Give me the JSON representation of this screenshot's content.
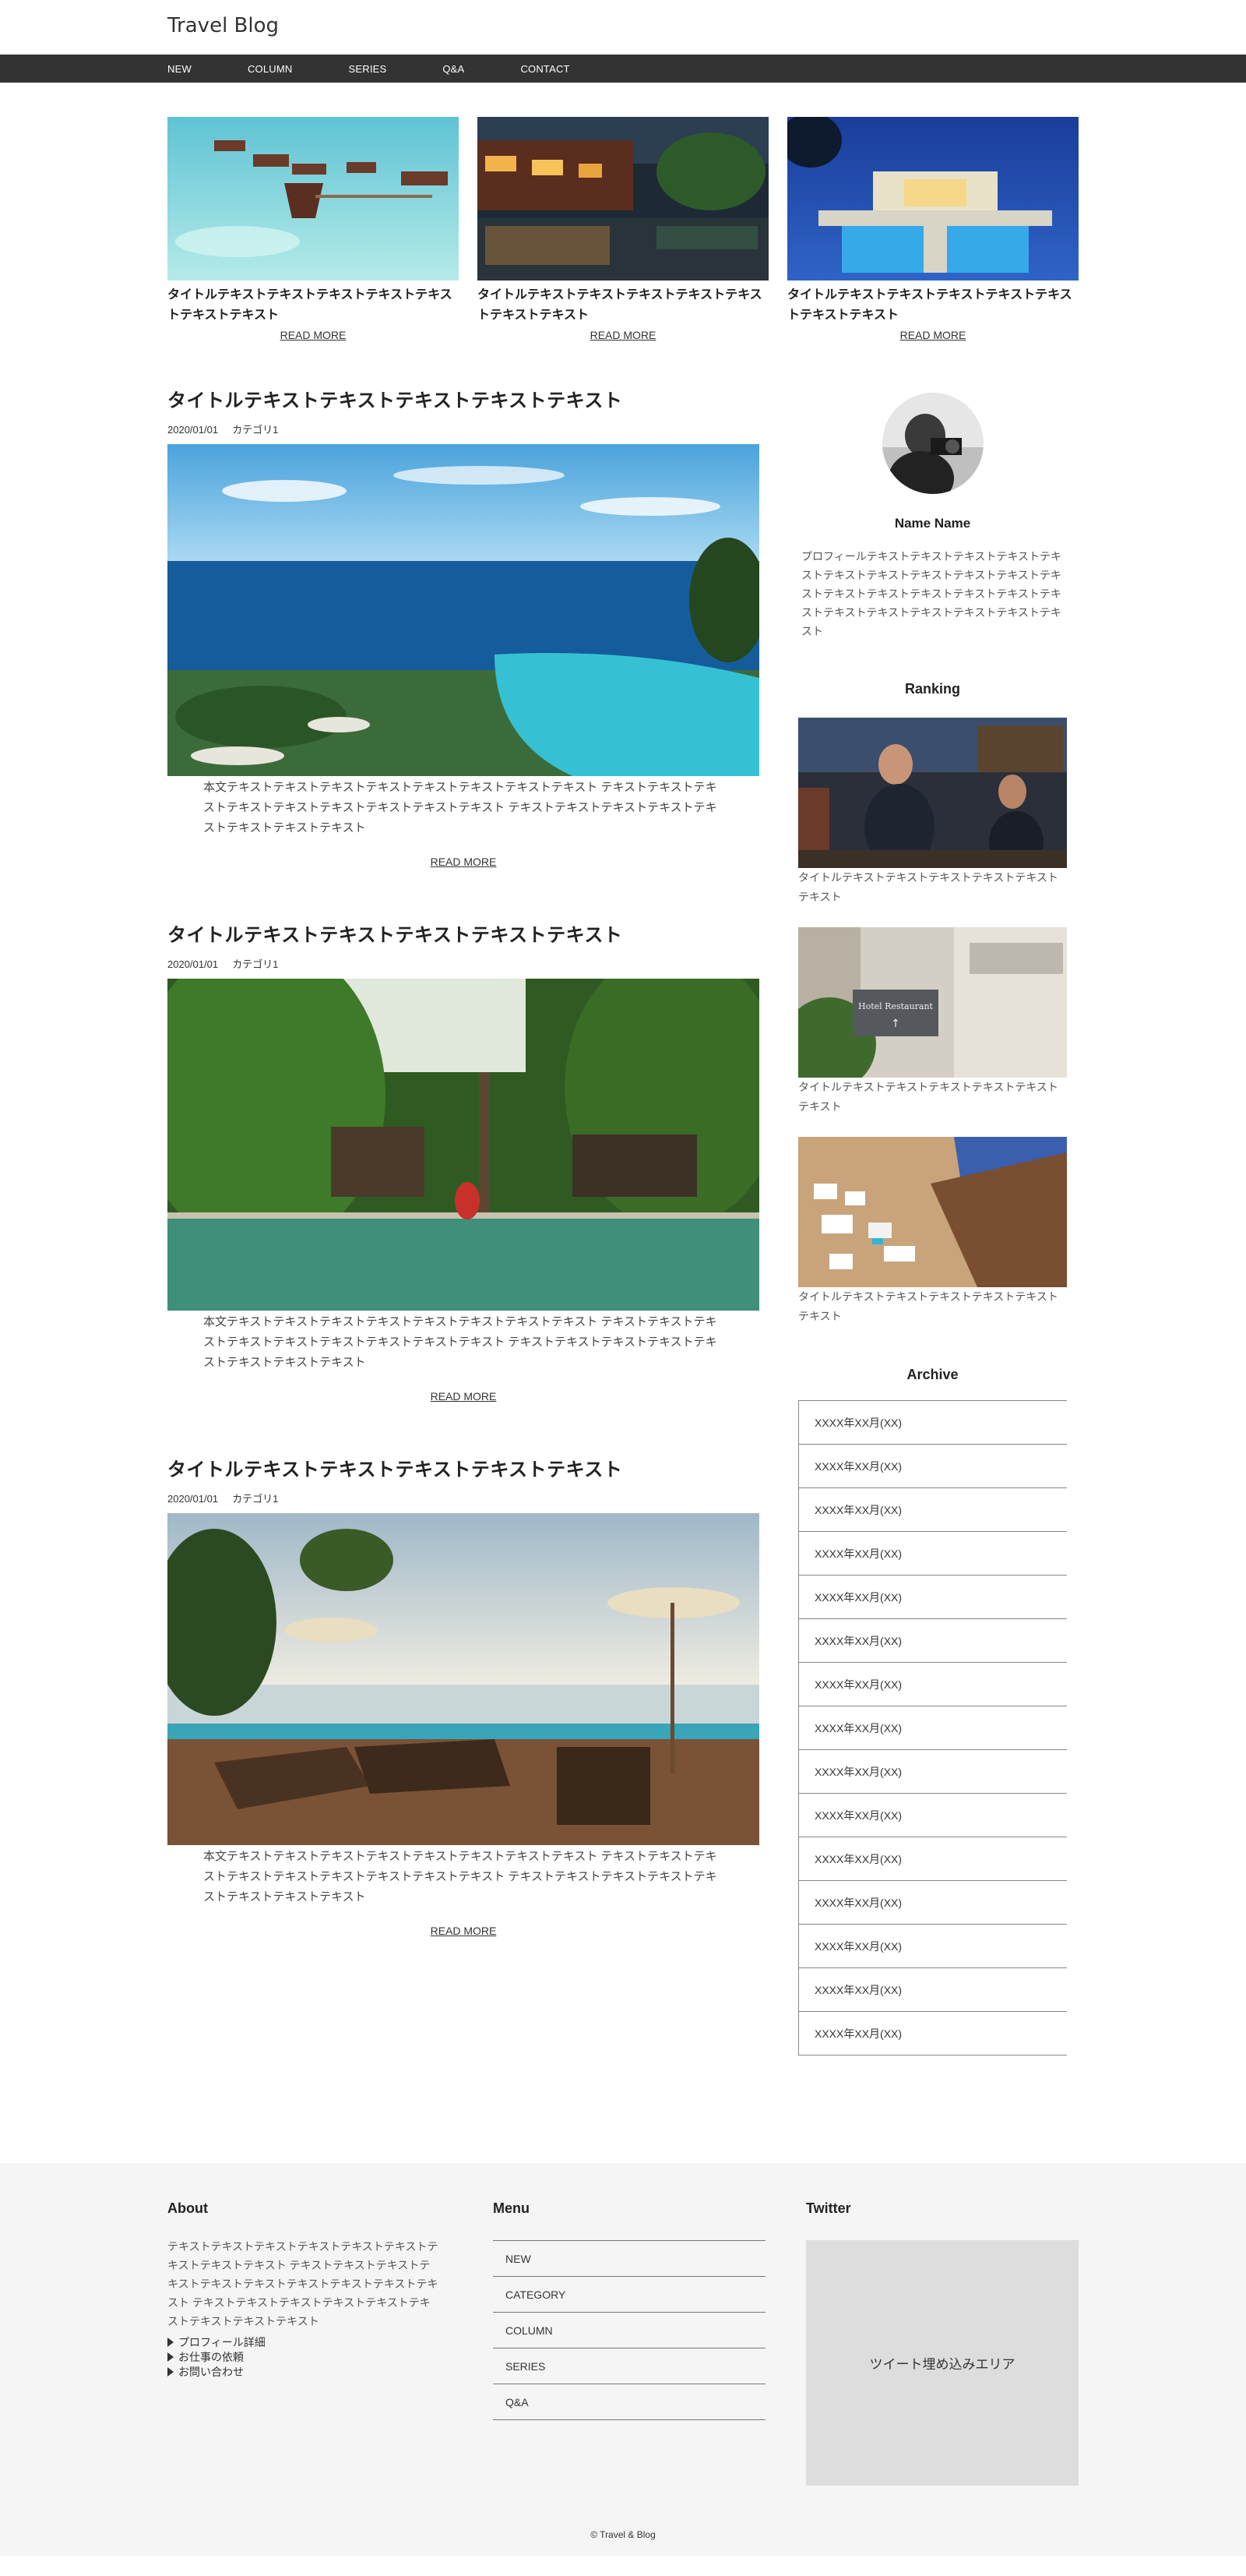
{
  "site": {
    "title": "Travel Blog"
  },
  "nav": {
    "items": [
      "NEW",
      "COLUMN",
      "SERIES",
      "Q&A",
      "CONTACT"
    ]
  },
  "pickup": [
    {
      "title": "タイトルテキストテキストテキストテキストテキストテキストテキスト",
      "more": "READ MORE"
    },
    {
      "title": "タイトルテキストテキストテキストテキストテキストテキストテキスト",
      "more": "READ MORE"
    },
    {
      "title": "タイトルテキストテキストテキストテキストテキストテキストテキスト",
      "more": "READ MORE"
    }
  ],
  "posts": [
    {
      "title": "タイトルテキストテキストテキストテキストテキスト",
      "date": "2020/01/01",
      "category": "カテゴリ1",
      "body": "本文テキストテキストテキストテキストテキストテキストテキストテキスト テキストテキストテキストテキストテキストテキストテキストテキストテキスト テキストテキストテキストテキストテキストテキストテキストテキスト",
      "more": "READ MORE"
    },
    {
      "title": "タイトルテキストテキストテキストテキストテキスト",
      "date": "2020/01/01",
      "category": "カテゴリ1",
      "body": "本文テキストテキストテキストテキストテキストテキストテキストテキスト テキストテキストテキストテキストテキストテキストテキストテキストテキスト テキストテキストテキストテキストテキストテキストテキストテキスト",
      "more": "READ MORE"
    },
    {
      "title": "タイトルテキストテキストテキストテキストテキスト",
      "date": "2020/01/01",
      "category": "カテゴリ1",
      "body": "本文テキストテキストテキストテキストテキストテキストテキストテキスト テキストテキストテキストテキストテキストテキストテキストテキストテキスト テキストテキストテキストテキストテキストテキストテキストテキスト",
      "more": "READ MORE"
    }
  ],
  "profile": {
    "name": "Name Name",
    "text": "プロフィールテキストテキストテキストテキストテキストテキストテキストテキストテキストテキストテキストテキストテキストテキストテキストテキストテキストテキストテキストテキストテキストテキストテキスト"
  },
  "ranking": {
    "heading": "Ranking",
    "items": [
      {
        "text": "タイトルテキストテキストテキストテキストテキストテキスト"
      },
      {
        "text": "タイトルテキストテキストテキストテキストテキストテキスト"
      },
      {
        "text": "タイトルテキストテキストテキストテキストテキストテキスト"
      }
    ]
  },
  "archive": {
    "heading": "Archive",
    "items": [
      "XXXX年XX月(XX)",
      "XXXX年XX月(XX)",
      "XXXX年XX月(XX)",
      "XXXX年XX月(XX)",
      "XXXX年XX月(XX)",
      "XXXX年XX月(XX)",
      "XXXX年XX月(XX)",
      "XXXX年XX月(XX)",
      "XXXX年XX月(XX)",
      "XXXX年XX月(XX)",
      "XXXX年XX月(XX)",
      "XXXX年XX月(XX)",
      "XXXX年XX月(XX)",
      "XXXX年XX月(XX)",
      "XXXX年XX月(XX)"
    ]
  },
  "footer": {
    "about_heading": "About",
    "about_text": "テキストテキストテキストテキストテキストテキストテキストテキストテキスト テキストテキストテキストテキストテキストテキストテキストテキストテキストテキスト テキストテキストテキストテキストテキストテキストテキストテキストテキスト",
    "about_links": [
      "プロフィール詳細",
      "お仕事の依頼",
      "お問い合わせ"
    ],
    "menu_heading": "Menu",
    "menu_items": [
      "NEW",
      "CATEGORY",
      "COLUMN",
      "SERIES",
      "Q&A"
    ],
    "twitter_heading": "Twitter",
    "tweet_placeholder": "ツイート埋め込みエリア",
    "copyright": "© Travel & Blog"
  }
}
